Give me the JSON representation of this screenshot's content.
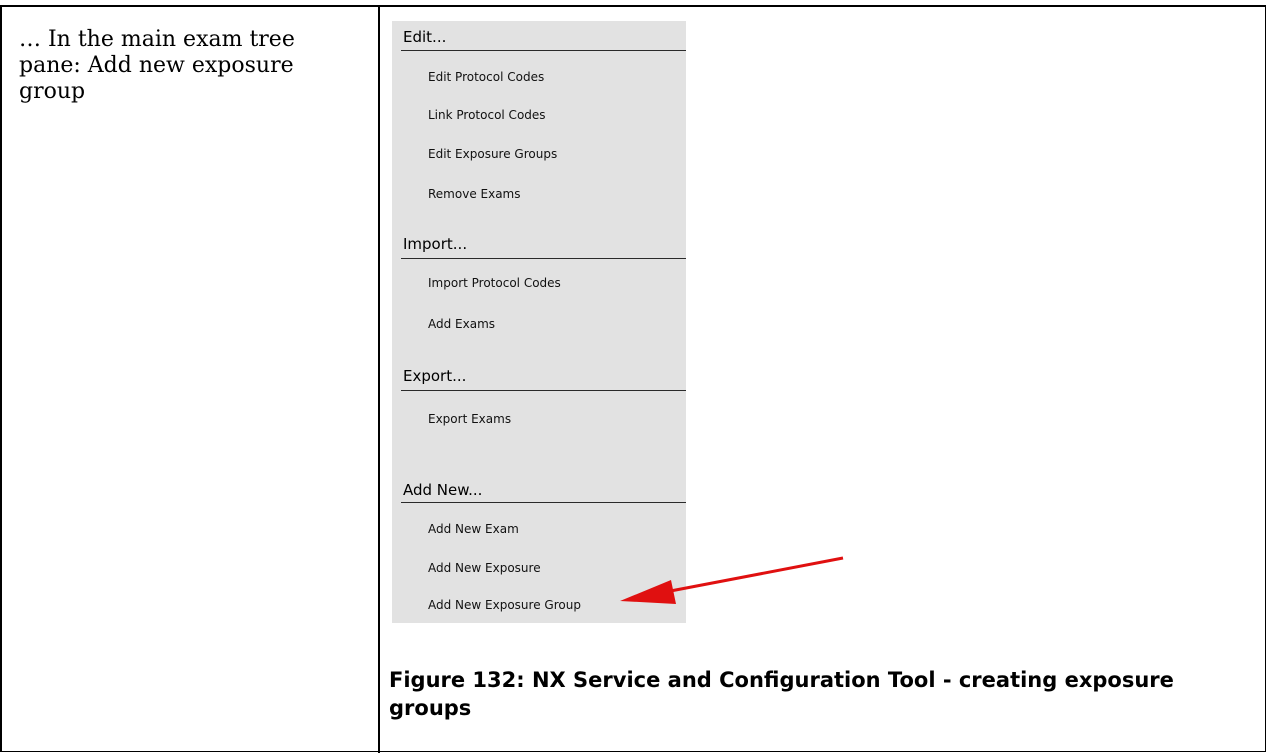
{
  "left_cell": {
    "text": "… In the main exam tree pane: Add new exposure group"
  },
  "menu": {
    "sections": [
      {
        "heading": "Edit...",
        "items": [
          "Edit Protocol Codes",
          "Link Protocol Codes",
          "Edit Exposure Groups",
          "Remove Exams"
        ]
      },
      {
        "heading": "Import...",
        "items": [
          "Import Protocol Codes",
          "Add Exams"
        ]
      },
      {
        "heading": "Export...",
        "items": [
          "Export Exams"
        ]
      },
      {
        "heading": "Add New...",
        "items": [
          "Add New Exam",
          "Add New Exposure",
          "Add New Exposure Group"
        ]
      }
    ]
  },
  "annotation": {
    "arrow_color": "#e01010",
    "target": "Add New Exposure Group",
    "icon": "red-arrow-icon"
  },
  "caption": {
    "text": "Figure 132: NX Service and Configuration Tool - creating exposure groups"
  }
}
